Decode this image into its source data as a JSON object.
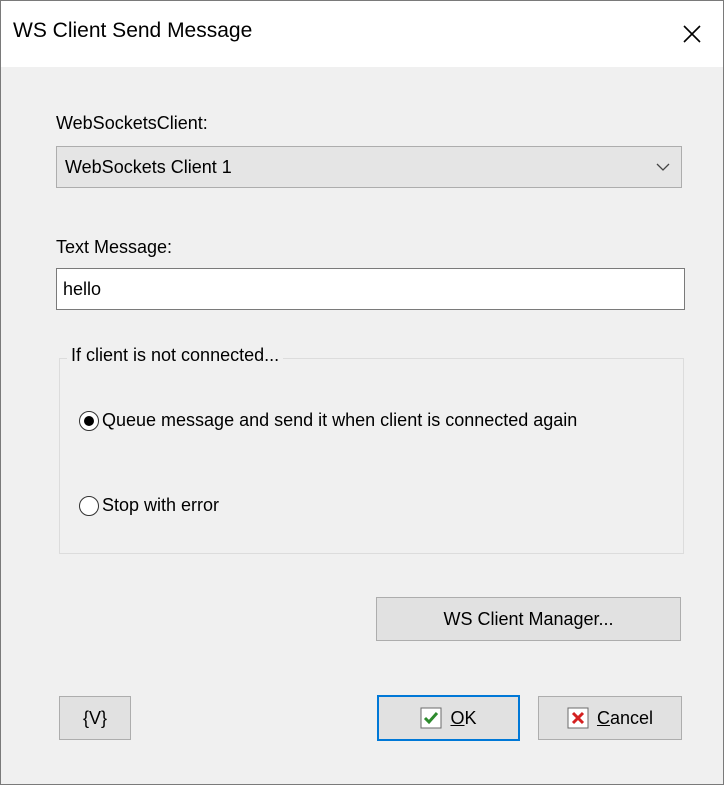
{
  "window": {
    "title": "WS Client Send Message"
  },
  "client": {
    "label": "WebSocketsClient:",
    "selected": "WebSockets Client 1"
  },
  "message": {
    "label": "Text Message:",
    "value": "hello"
  },
  "fallback": {
    "title": "If client is not connected...",
    "options": [
      {
        "label": "Queue message and send it when client is connected again",
        "checked": true
      },
      {
        "label": "Stop with error",
        "checked": false
      }
    ]
  },
  "buttons": {
    "manager": "WS Client Manager...",
    "variables": "{V}",
    "ok_underlined": "O",
    "ok_rest": "K",
    "cancel_underlined": "C",
    "cancel_rest": "ancel"
  },
  "colors": {
    "ok_check": "#2e8b2e",
    "cancel_x": "#d42020",
    "default_border": "#0078d7"
  }
}
